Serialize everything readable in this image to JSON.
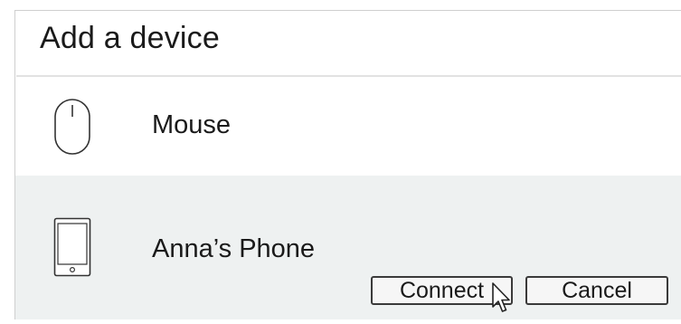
{
  "dialog": {
    "title": "Add a device",
    "devices": [
      {
        "name": "Mouse",
        "icon": "mouse-icon",
        "selected": false
      },
      {
        "name": "Anna’s Phone",
        "icon": "phone-icon",
        "selected": true
      }
    ],
    "actions": {
      "connect_label": "Connect",
      "cancel_label": "Cancel"
    }
  },
  "colors": {
    "selected_row_background": "#eef1f1",
    "divider": "#e2e2e2",
    "text": "#1a1a1a",
    "button_border": "#3a3a3a"
  },
  "pointer": {
    "icon": "arrow-cursor-icon",
    "hovering": "connect-button"
  }
}
